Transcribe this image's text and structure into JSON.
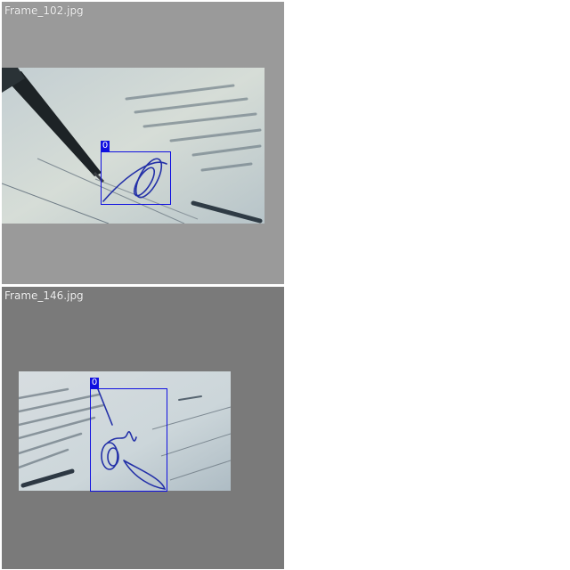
{
  "viewer": {
    "frames": [
      {
        "filename": "Frame_102.jpg",
        "tile_bg": "#9a9a9a",
        "detections": [
          {
            "label": "0",
            "color": "#1010e0"
          }
        ]
      },
      {
        "filename": "Frame_146.jpg",
        "tile_bg": "#7a7a7a",
        "detections": [
          {
            "label": "0",
            "color": "#1010e0"
          }
        ]
      }
    ]
  }
}
